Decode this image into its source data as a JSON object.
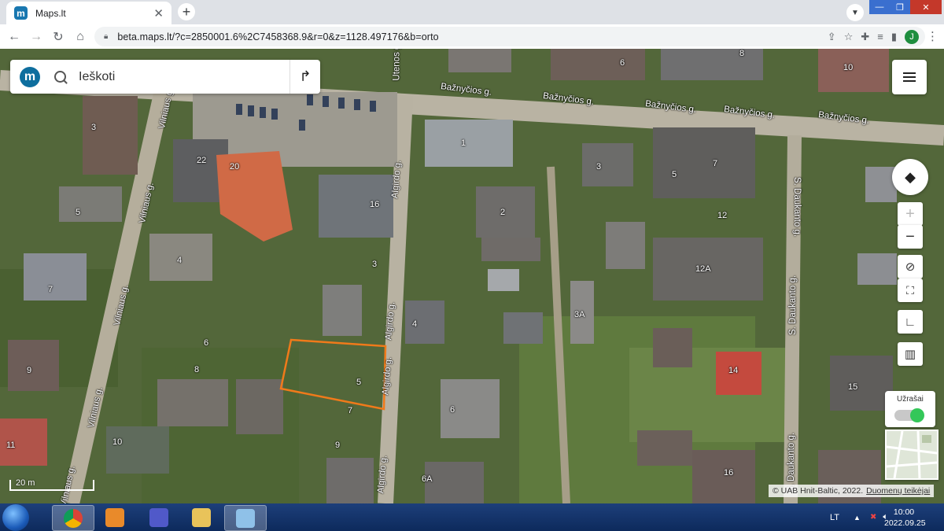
{
  "browser": {
    "tab_title": "Maps.lt",
    "url": "beta.maps.lt/?c=2850001.6%2C7458368.9&r=0&z=1128.497176&b=orto",
    "profile_initial": "J"
  },
  "map": {
    "search_placeholder": "Ieškoti",
    "logo_letter": "m",
    "layers_label": "Užrašai",
    "scale_label": "20 m",
    "attribution": "© UAB Hnit-Baltic, 2022.",
    "attribution_link": "Duomenų teikėjai",
    "streets": [
      {
        "name": "Bažnyčios g.",
        "id": "baznycios-1"
      },
      {
        "name": "Bažnyčios g.",
        "id": "baznycios-2"
      },
      {
        "name": "Bažnyčios g.",
        "id": "baznycios-3"
      },
      {
        "name": "Bažnyčios g.",
        "id": "baznycios-4"
      },
      {
        "name": "Bažnyčios g.",
        "id": "baznycios-5"
      },
      {
        "name": "Algirdo g.",
        "id": "algirdo-1"
      },
      {
        "name": "Algirdo g.",
        "id": "algirdo-2"
      },
      {
        "name": "Algirdo g.",
        "id": "algirdo-3"
      },
      {
        "name": "Algirdo g.",
        "id": "algirdo-4"
      },
      {
        "name": "Vilniaus g.",
        "id": "vilniaus-1"
      },
      {
        "name": "Vilniaus g.",
        "id": "vilniaus-2"
      },
      {
        "name": "Vilniaus g.",
        "id": "vilniaus-3"
      },
      {
        "name": "Vilniaus g.",
        "id": "vilniaus-4"
      },
      {
        "name": "Vilniaus g.",
        "id": "vilniaus-5"
      },
      {
        "name": "S. Daukanto g.",
        "id": "daukanto-1"
      },
      {
        "name": "S. Daukanto g.",
        "id": "daukanto-2"
      },
      {
        "name": "S. Daukanto g.",
        "id": "daukanto-3"
      },
      {
        "name": "Utenos g.",
        "id": "utenos-1"
      }
    ],
    "house_numbers": [
      "10",
      "6",
      "8",
      "3",
      "1",
      "3",
      "5",
      "7",
      "22",
      "20",
      "16",
      "2",
      "12",
      "5",
      "4",
      "3",
      "12A",
      "7",
      "4",
      "3A",
      "6",
      "8",
      "5",
      "7",
      "14",
      "15",
      "9",
      "6",
      "10",
      "9",
      "11",
      "16",
      "6A"
    ]
  },
  "taskbar": {
    "language": "LT",
    "time": "10:00",
    "date": "2022.09.25"
  },
  "colors": {
    "accent": "#1877b0",
    "highlight": "#f07a1a",
    "toggle_on": "#34c759"
  }
}
